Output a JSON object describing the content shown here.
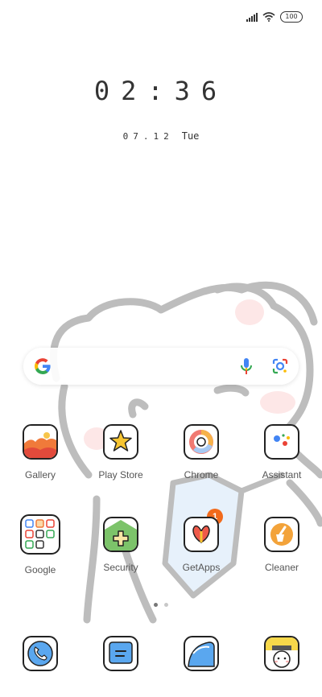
{
  "status_bar": {
    "battery": "100",
    "signal_icon": "signal-bars-icon",
    "wifi_icon": "wifi-icon"
  },
  "lock": {
    "time": "02:36",
    "date": "07.12",
    "weekday": "Tue"
  },
  "search": {
    "logo": "google-g-icon",
    "mic_icon": "mic-icon",
    "lens_icon": "lens-icon"
  },
  "apps_row1": [
    {
      "label": "Gallery",
      "icon": "gallery-icon"
    },
    {
      "label": "Play Store",
      "icon": "play-store-icon"
    },
    {
      "label": "Chrome",
      "icon": "chrome-icon"
    },
    {
      "label": "Assistant",
      "icon": "assistant-icon"
    }
  ],
  "apps_row2": [
    {
      "label": "Google",
      "icon": "google-folder-icon"
    },
    {
      "label": "Security",
      "icon": "security-icon"
    },
    {
      "label": "GetApps",
      "icon": "getapps-icon",
      "badge": "1"
    },
    {
      "label": "Cleaner",
      "icon": "cleaner-icon"
    }
  ],
  "dock": [
    {
      "icon": "phone-icon"
    },
    {
      "icon": "messages-icon"
    },
    {
      "icon": "browser-icon"
    },
    {
      "icon": "camera-icon"
    }
  ],
  "pager": {
    "pages": 2,
    "current": 1
  },
  "colors": {
    "orange_badge": "#f26a1b",
    "google_blue": "#4285F4",
    "google_red": "#EA4335",
    "google_yellow": "#FBBC05",
    "google_green": "#34A853"
  }
}
